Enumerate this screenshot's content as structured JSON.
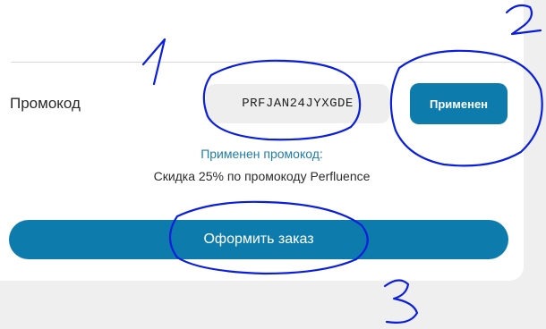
{
  "promo": {
    "label": "Промокод",
    "code_value": "PRFJAN24JYXGDE",
    "apply_label": "Применен"
  },
  "applied": {
    "title": "Применен промокод:",
    "description": "Скидка 25% по промокоду Perfluence"
  },
  "checkout": {
    "order_label": "Оформить заказ"
  },
  "annotations": {
    "ink_color": "#0a1ee0",
    "digits": [
      "1",
      "2",
      "3"
    ]
  },
  "colors": {
    "accent": "#0d7cac",
    "accent_text": "#1f7ea8"
  }
}
